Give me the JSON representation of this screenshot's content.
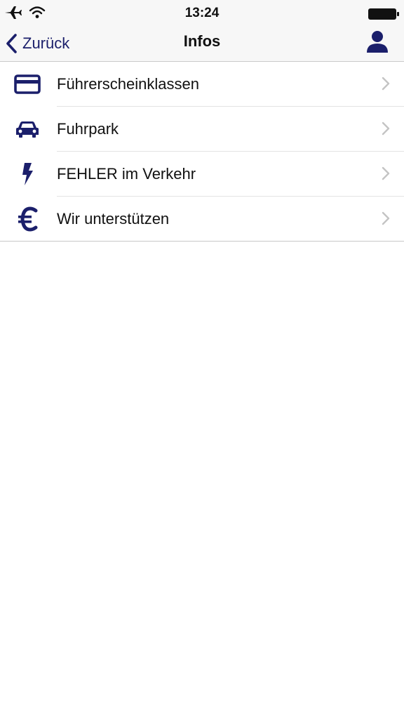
{
  "status_bar": {
    "time": "13:24",
    "icons": [
      "airplane-icon",
      "wifi-icon",
      "battery-icon"
    ]
  },
  "nav": {
    "back_label": "Zurück",
    "title": "Infos",
    "right_icon": "user-icon"
  },
  "colors": {
    "accent": "#1b1f6b",
    "separator": "#e3e3e3",
    "bar_background": "#f7f7f7",
    "chevron": "#c4c4c4"
  },
  "menu": {
    "items": [
      {
        "label": "Führerscheinklassen",
        "icon": "credit-card-icon"
      },
      {
        "label": "Fuhrpark",
        "icon": "car-icon"
      },
      {
        "label": "FEHLER im Verkehr",
        "icon": "lightning-icon"
      },
      {
        "label": "Wir unterstützen",
        "icon": "euro-icon"
      }
    ]
  }
}
